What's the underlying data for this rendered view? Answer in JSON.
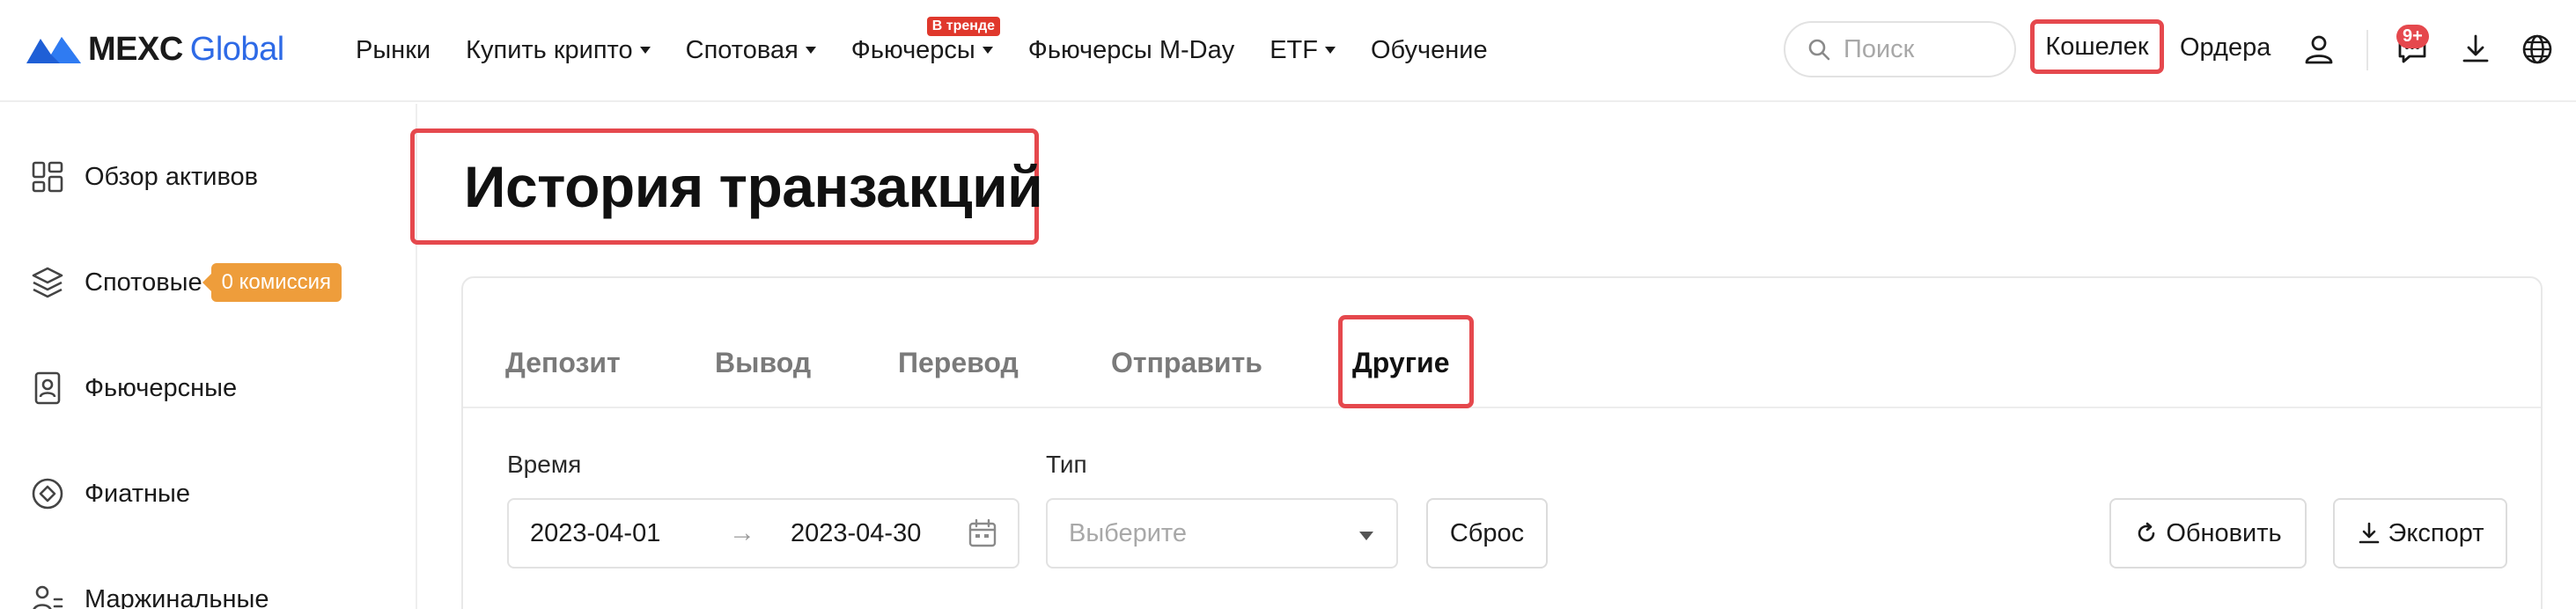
{
  "brand": {
    "name_bold": "MEXC",
    "name_light": "Global",
    "accent": "#2e6ae6"
  },
  "nav": {
    "items": [
      {
        "label": "Рынки",
        "dropdown": false
      },
      {
        "label": "Купить крипто",
        "dropdown": true
      },
      {
        "label": "Спотовая",
        "dropdown": true
      },
      {
        "label": "Фьючерсы",
        "dropdown": true,
        "badge": "В тренде"
      },
      {
        "label": "Фьючерсы M-Day",
        "dropdown": false
      },
      {
        "label": "ETF",
        "dropdown": true
      },
      {
        "label": "Обучение",
        "dropdown": false
      }
    ]
  },
  "header": {
    "search_placeholder": "Поиск",
    "wallet_label": "Кошелек",
    "orders_label": "Ордера",
    "notification_count": "9+",
    "icons": [
      "user-icon",
      "chat-icon",
      "download-icon",
      "globe-icon"
    ]
  },
  "sidebar": {
    "items": [
      {
        "label": "Обзор активов",
        "icon": "grid-icon"
      },
      {
        "label": "Спотовые",
        "icon": "layers-icon",
        "badge": "0 комиссия"
      },
      {
        "label": "Фьючерсные",
        "icon": "futures-icon"
      },
      {
        "label": "Фиатные",
        "icon": "fiat-icon"
      },
      {
        "label": "Маржинальные",
        "icon": "margin-icon"
      }
    ]
  },
  "main": {
    "title": "История транзакций",
    "tabs": [
      {
        "label": "Депозит",
        "active": false
      },
      {
        "label": "Вывод",
        "active": false
      },
      {
        "label": "Перевод",
        "active": false
      },
      {
        "label": "Отправить",
        "active": false
      },
      {
        "label": "Другие",
        "active": true
      }
    ],
    "filters": {
      "time_label": "Время",
      "date_from": "2023-04-01",
      "date_to": "2023-04-30",
      "type_label": "Тип",
      "type_placeholder": "Выберите",
      "reset_label": "Сброс",
      "refresh_label": "Обновить",
      "export_label": "Экспорт"
    }
  },
  "colors": {
    "highlight": "#e5484d",
    "fee_badge": "#ee9d3b",
    "trend_badge": "#e0382c"
  }
}
